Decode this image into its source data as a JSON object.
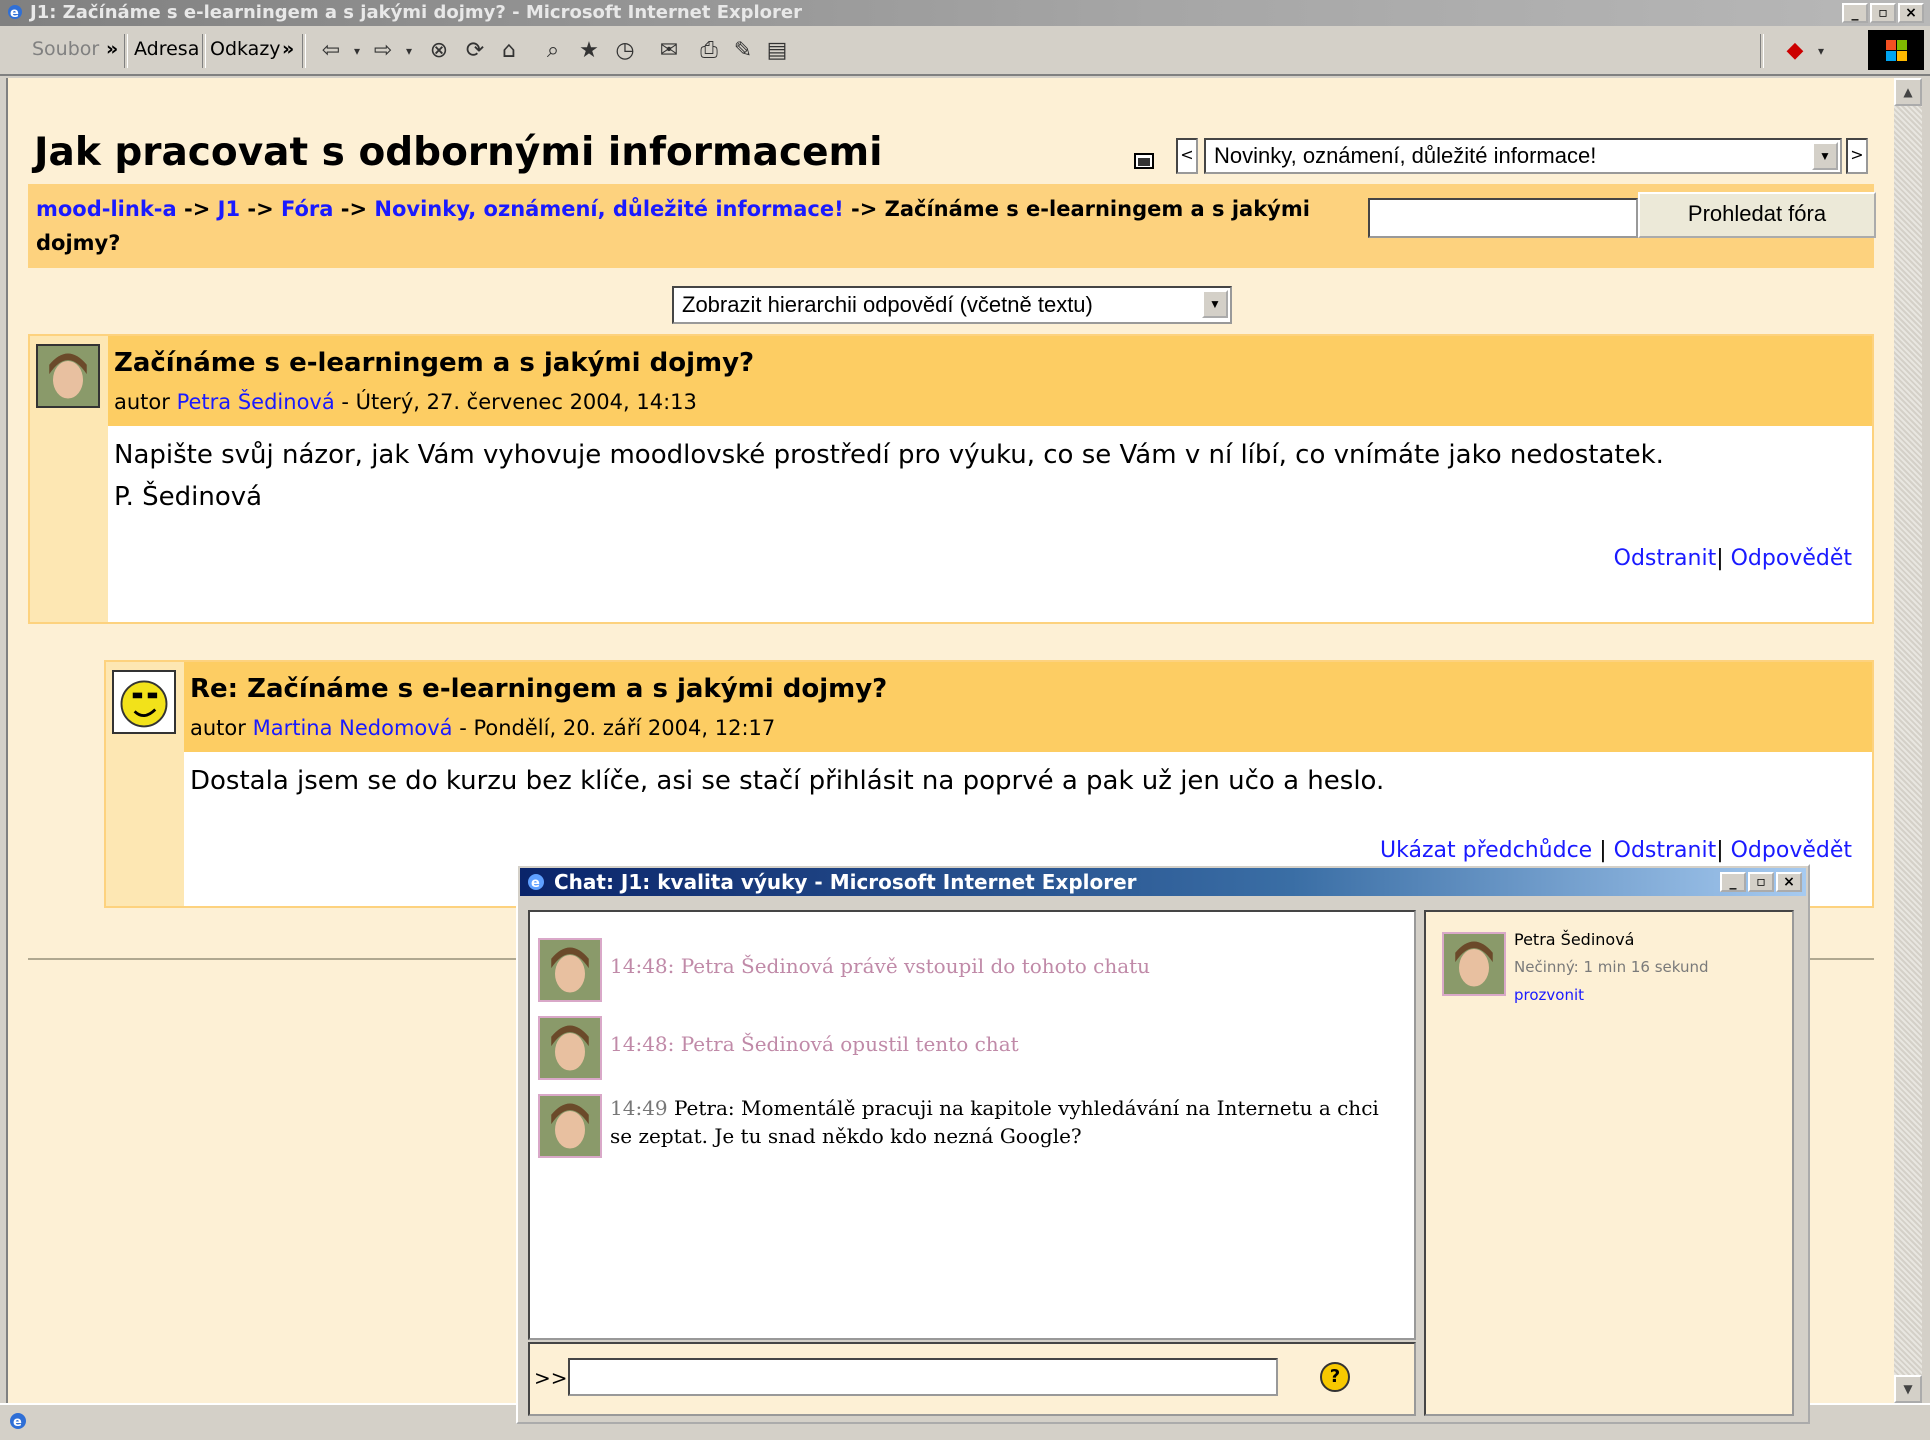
{
  "browser": {
    "title": "J1: Začínáme s e-learningem a s jakými dojmy? - Microsoft Internet Explorer",
    "toolbar": {
      "file_label": "Soubor",
      "address_label": "Adresa",
      "links_label": "Odkazy",
      "chevron": "»"
    },
    "window_buttons": [
      "_",
      "▫",
      "×"
    ]
  },
  "page": {
    "title": "Jak pracovat s odbornými informacemi",
    "forum_jump": {
      "selected": "Novinky, oznámení, důležité informace!"
    },
    "breadcrumb": {
      "items": [
        "mood-link-a",
        "J1",
        "Fóra",
        "Novinky, oznámení, důležité informace!"
      ],
      "separator": "->",
      "current": "Začínáme s e-learningem a s jakými dojmy?"
    },
    "search": {
      "button_label": "Prohledat fóra",
      "value": ""
    },
    "display_mode": {
      "selected": "Zobrazit hierarchii odpovědí (včetně textu)"
    },
    "posts": [
      {
        "subject": "Začínáme s e-learningem a s jakými dojmy?",
        "author_prefix": "autor",
        "author": "Petra Šedinová",
        "date": "- Úterý, 27. červenec 2004, 14:13",
        "body_line1": "Napište svůj názor, jak Vám vyhovuje moodlovské prostředí pro výuku, co se Vám v ní líbí, co vnímáte jako nedostatek.",
        "body_line2": "P. Šedinová",
        "delete_label": "Odstranit",
        "reply_label": "Odpovědět"
      },
      {
        "subject": "Re: Začínáme s e-learningem a s jakými dojmy?",
        "author_prefix": "autor",
        "author": "Martina Nedomová",
        "date": "- Pondělí, 20. září 2004, 12:17",
        "body_line1": "Dostala jsem se do kurzu bez klíče, asi se stačí přihlásit na poprvé a pak už jen učo a heslo.",
        "show_parent_label": "Ukázat předchůdce",
        "delete_label": "Odstranit",
        "reply_label": "Odpovědět"
      }
    ]
  },
  "chat_window": {
    "title": "Chat: J1: kvalita výuky - Microsoft Internet Explorer",
    "messages": [
      {
        "text": "14:48: Petra Šedinová právě vstoupil do tohoto chatu"
      },
      {
        "text": "14:48: Petra Šedinová opustil tento chat"
      },
      {
        "time": "14:49",
        "sender": "Petra:",
        "text_line1": "Momentálě pracuji na kapitole vyhledávání na Internetu a chci",
        "text_line2": "se zeptat. Je tu snad někdo kdo nezná Google?"
      }
    ],
    "users": [
      {
        "name": "Petra Šedinová",
        "idle": "Nečinný: 1 min 16 sekund",
        "beep_label": "prozvonit"
      }
    ],
    "prompt": ">>",
    "input_value": "",
    "help_symbol": "?"
  },
  "colors": {
    "header_bar": "#fdd27e",
    "post_header": "#fdcd63",
    "link": "#1a1aff",
    "chat_title": "#0a246a"
  }
}
